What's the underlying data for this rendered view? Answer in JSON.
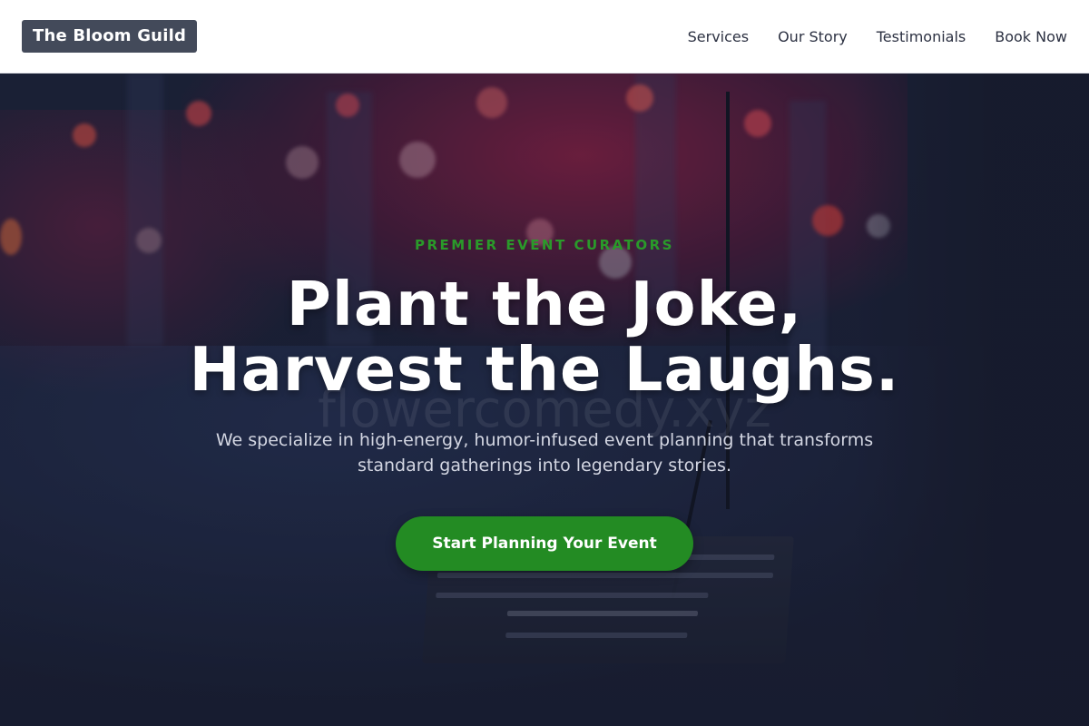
{
  "header": {
    "logo": "The Bloom Guild",
    "nav": [
      {
        "label": "Services"
      },
      {
        "label": "Our Story"
      },
      {
        "label": "Testimonials"
      },
      {
        "label": "Book Now"
      }
    ]
  },
  "hero": {
    "eyebrow": "PREMIER EVENT CURATORS",
    "headline_line1": "Plant the Joke,",
    "headline_line2": "Harvest the Laughs.",
    "watermark": "flowercomedy.xyz",
    "subtext": "We specialize in high-energy, humor-infused event planning that transforms standard gatherings into legendary stories.",
    "cta_label": "Start Planning Your Event"
  },
  "colors": {
    "accent_green": "#238b23",
    "eyebrow_green": "#2a9a2a",
    "logo_bg": "#434a5a",
    "hero_bg": "#1b2036"
  }
}
